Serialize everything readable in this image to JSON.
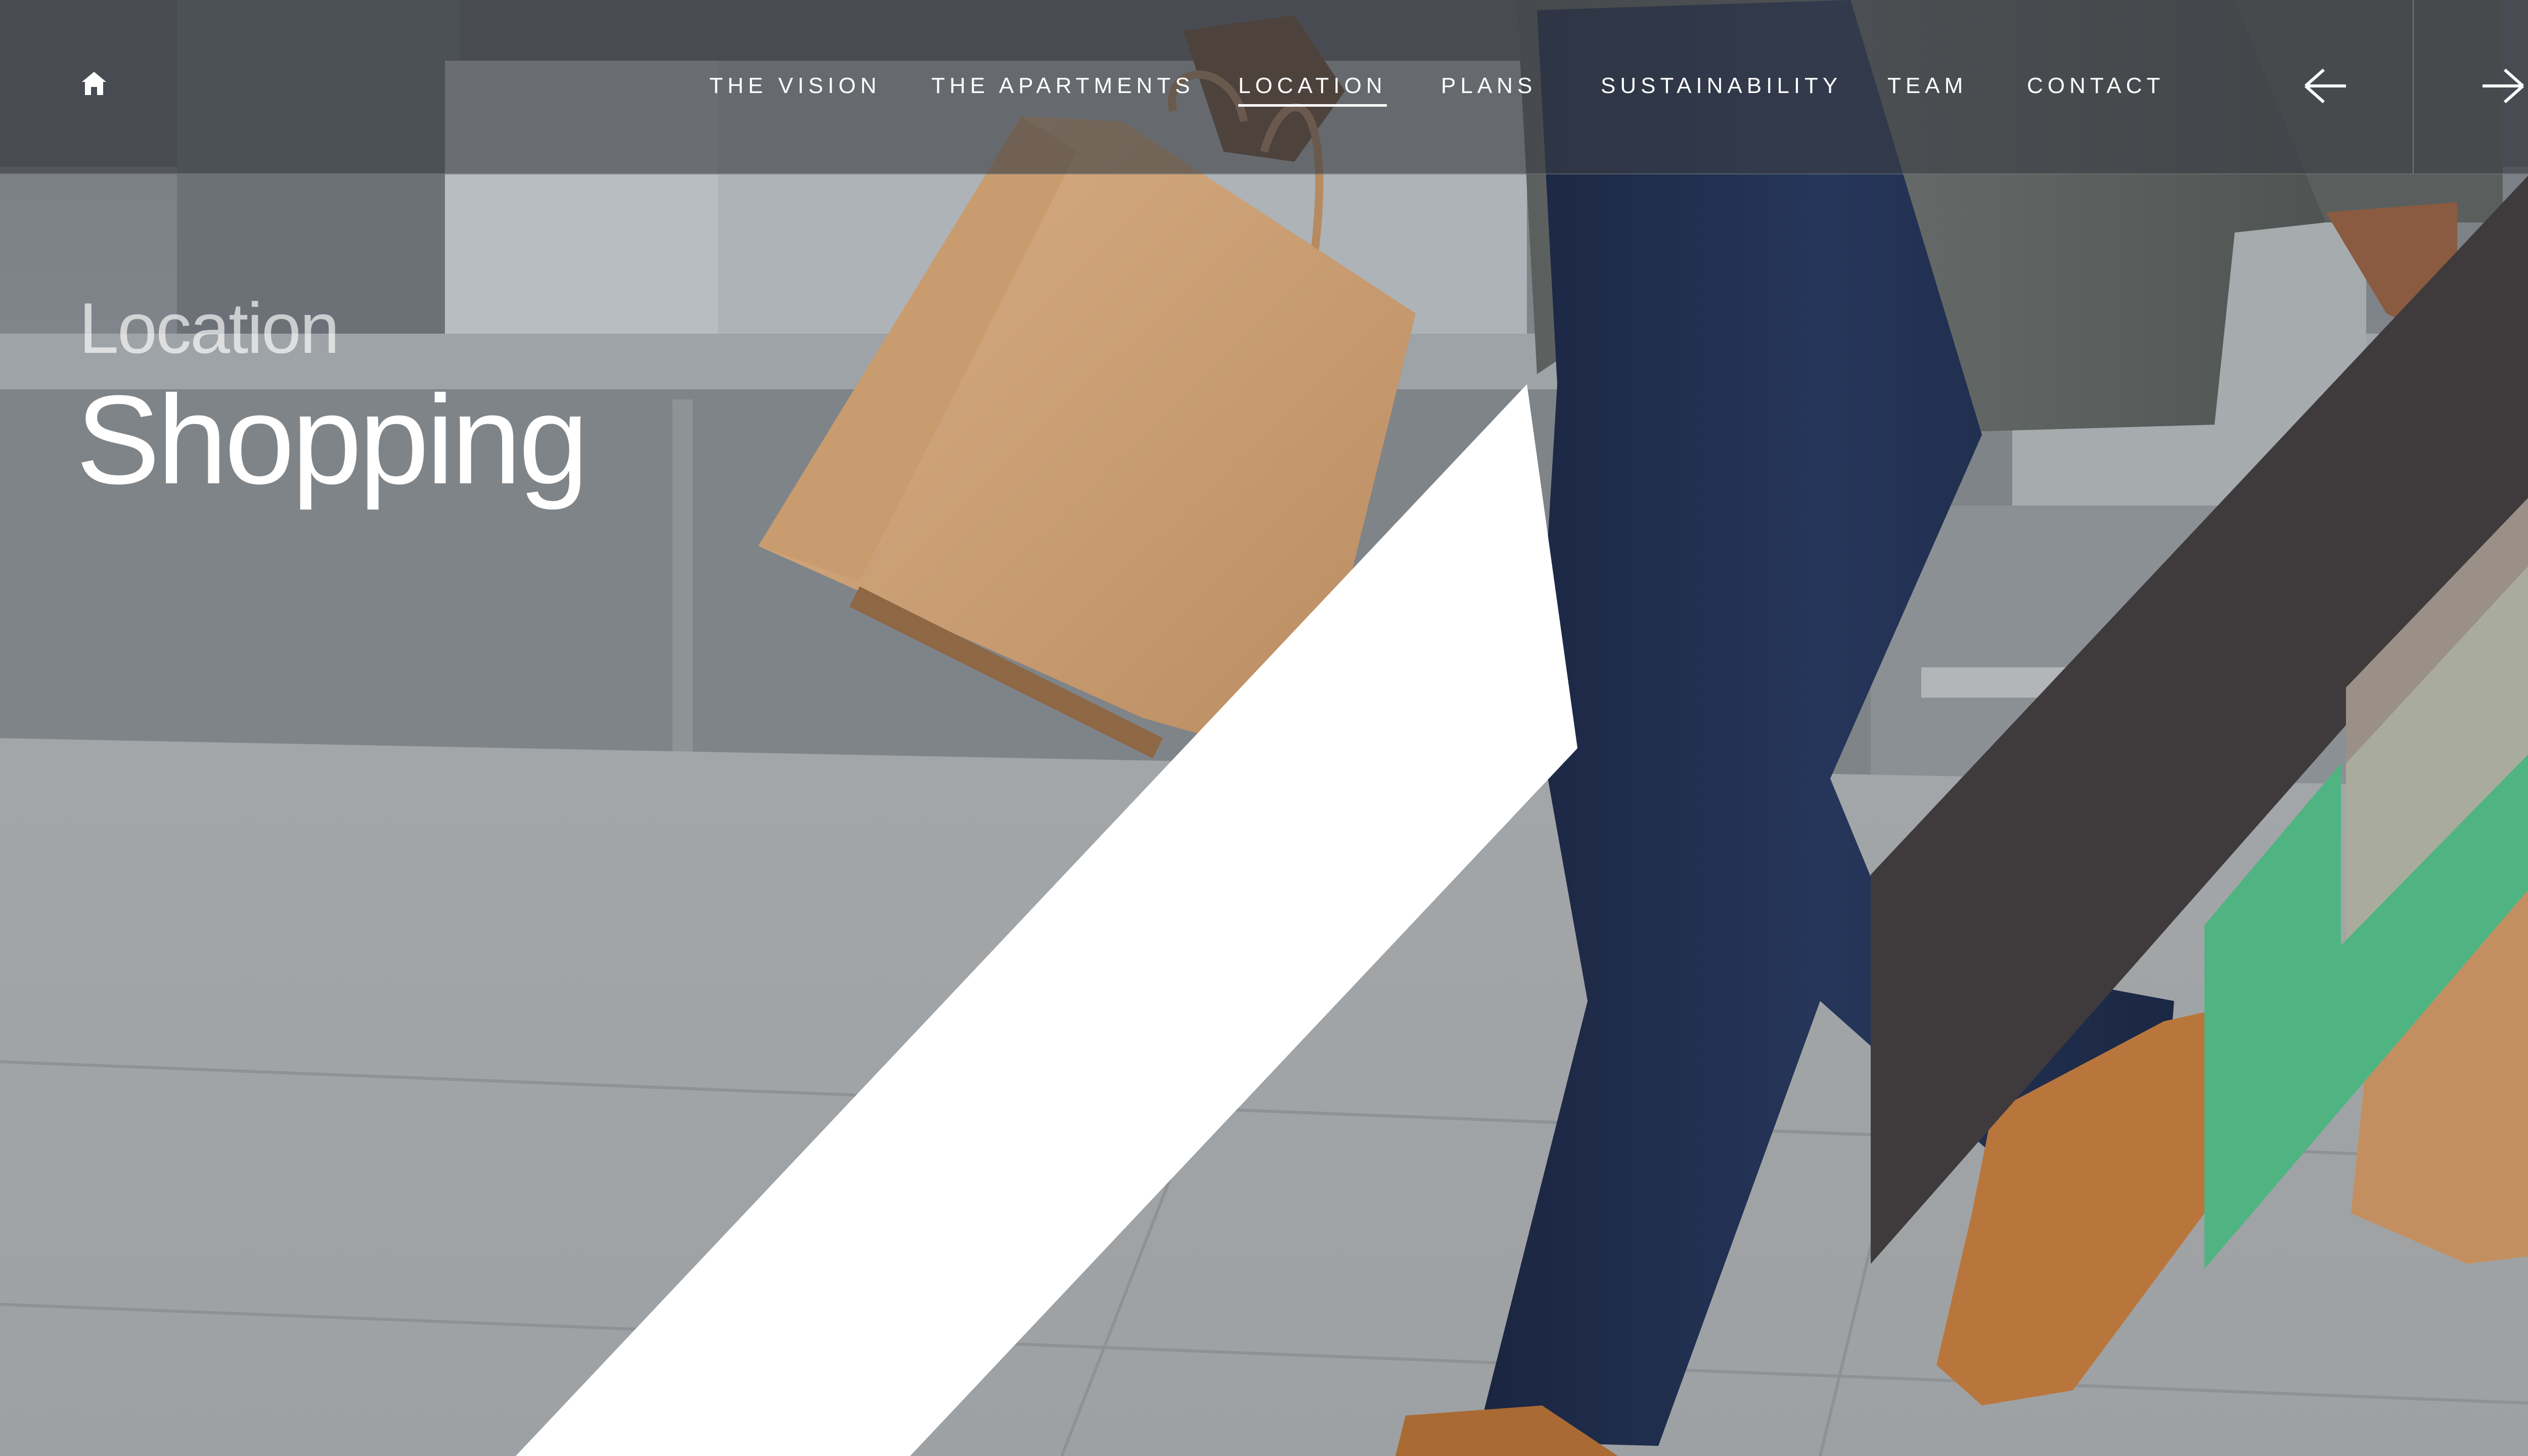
{
  "nav": {
    "home_icon": "home-icon",
    "links": [
      {
        "label": "THE VISION",
        "active": false
      },
      {
        "label": "THE APARTMENTS",
        "active": false
      },
      {
        "label": "LOCATION",
        "active": true
      },
      {
        "label": "PLANS",
        "active": false
      },
      {
        "label": "SUSTAINABILITY",
        "active": false
      },
      {
        "label": "TEAM",
        "active": false
      },
      {
        "label": "CONTACT",
        "active": false
      }
    ],
    "prev_icon": "arrow-left-icon",
    "next_icon": "arrow-right-icon"
  },
  "hero": {
    "subtitle": "Location",
    "title": "Shopping"
  },
  "colors": {
    "white_stripe": "#ffffff",
    "charcoal_band": "#3f3b3d",
    "taupe_band": "#9a9087",
    "sage_band": "#a9ac9c",
    "green_band": "#4fb482",
    "kraft_bag": "#c99a6c",
    "denim": "#1f2d4a",
    "coat": "#555a58",
    "shoe": "#b9763c"
  }
}
